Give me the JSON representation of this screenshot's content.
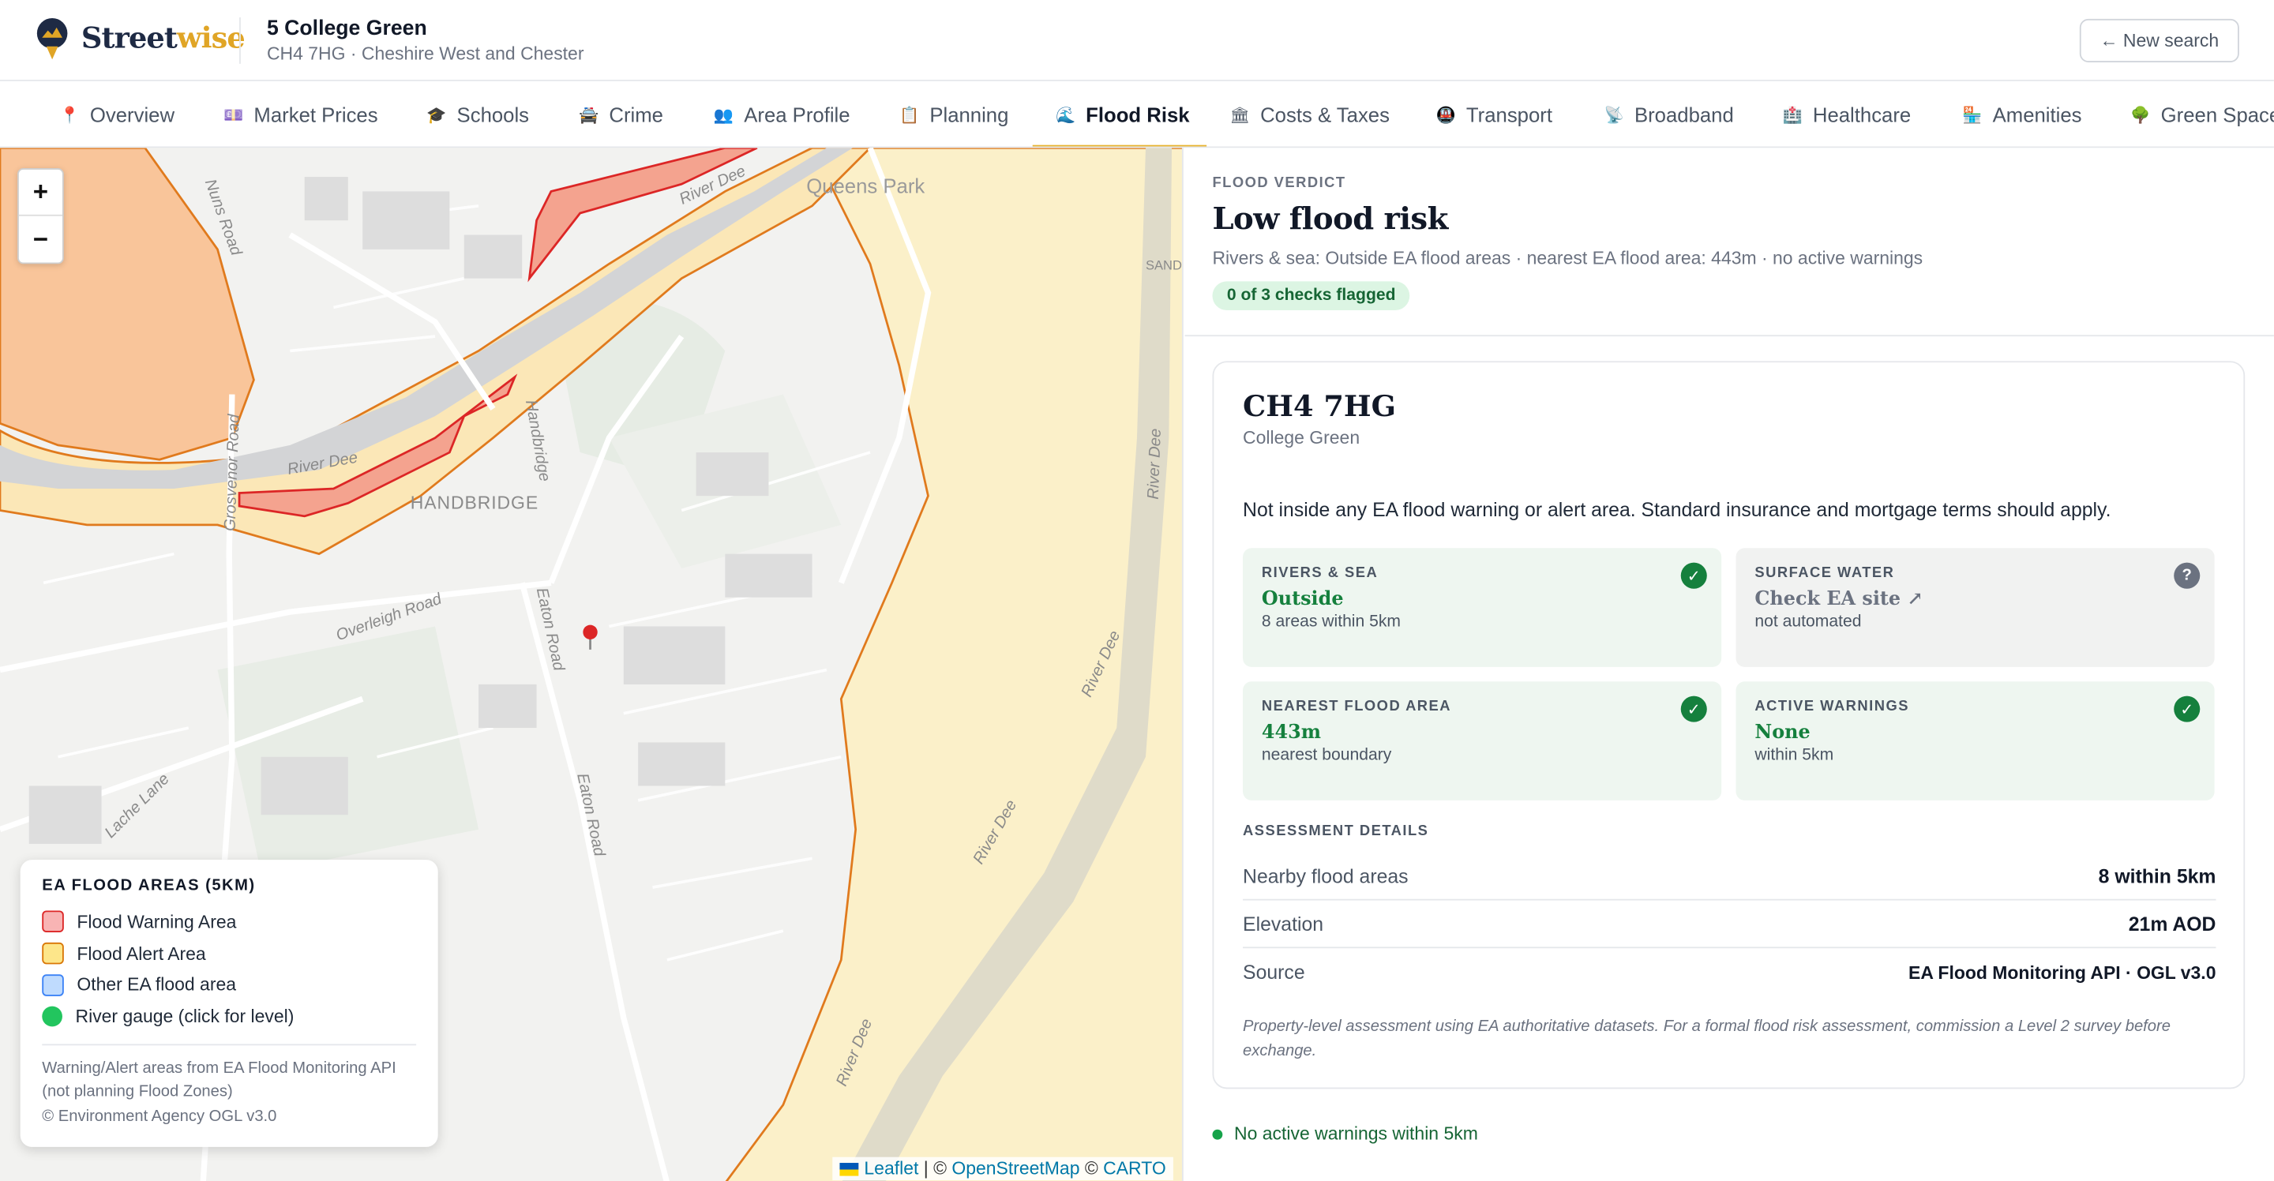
{
  "app": {
    "logo_street": "Street",
    "logo_wise": "wise",
    "new_search_label": "← New search"
  },
  "property": {
    "title": "5 College Green",
    "subtitle": "CH4 7HG · Cheshire West and Chester"
  },
  "tabs": [
    {
      "label": "Overview",
      "icon": "📍"
    },
    {
      "label": "Market Prices",
      "icon": "💷"
    },
    {
      "label": "Schools",
      "icon": "🎓"
    },
    {
      "label": "Crime",
      "icon": "🚔"
    },
    {
      "label": "Area Profile",
      "icon": "👥"
    },
    {
      "label": "Planning",
      "icon": "📋"
    },
    {
      "label": "Flood Risk",
      "icon": "🌊",
      "active": true
    },
    {
      "label": "Costs & Taxes",
      "icon": "🏛"
    },
    {
      "label": "Transport",
      "icon": "🚇"
    },
    {
      "label": "Broadband",
      "icon": "📡"
    },
    {
      "label": "Healthcare",
      "icon": "🏥"
    },
    {
      "label": "Amenities",
      "icon": "🏪"
    },
    {
      "label": "Green Space",
      "icon": "🌳"
    }
  ],
  "map": {
    "zoom_in": "+",
    "zoom_out": "−",
    "labels": {
      "queens_park": "Queens Park",
      "handbridge": "HANDBRIDGE",
      "river_dee": "River Dee",
      "nuns_road": "Nuns Road",
      "grosvenor_road": "Grosvenor Road",
      "handbridge_road": "Handbridge",
      "overleigh_road": "Overleigh Road",
      "eaton_road": "Eaton Road",
      "lache_lane": "Lache Lane",
      "sand": "SAND"
    },
    "legend": {
      "title": "EA FLOOD AREAS (5KM)",
      "items": [
        {
          "label": "Flood Warning Area",
          "color": "#f8b4b4",
          "border": "#dc2626"
        },
        {
          "label": "Flood Alert Area",
          "color": "#fde68a",
          "border": "#d97706"
        },
        {
          "label": "Other EA flood area",
          "color": "#bfdbfe",
          "border": "#3b82f6"
        },
        {
          "label": "River gauge (click for level)",
          "color": "#22c55e"
        }
      ],
      "note_line1": "Warning/Alert areas from EA Flood Monitoring API",
      "note_line2": "(not planning Flood Zones)",
      "note_line3": "© Environment Agency OGL v3.0"
    },
    "attribution": {
      "leaflet": "Leaflet",
      "sep1": " | © ",
      "osm": "OpenStreetMap",
      "sep2": " © ",
      "carto": "CARTO"
    }
  },
  "verdict": {
    "kicker": "FLOOD VERDICT",
    "title": "Low flood risk",
    "summary": "Rivers & sea: Outside EA flood areas · nearest EA flood area: 443m · no active warnings",
    "flag_pill": "0 of 3 checks flagged"
  },
  "card": {
    "postcode": "CH4 7HG",
    "street": "College Green",
    "summary": "Not inside any EA flood warning or alert area. Standard insurance and mortgage terms should apply.",
    "checks": [
      {
        "label": "RIVERS & SEA",
        "value": "Outside",
        "note": "8 areas within 5km",
        "status": "ok"
      },
      {
        "label": "SURFACE WATER",
        "value": "Check EA site ↗",
        "note": "not automated",
        "status": "unknown"
      },
      {
        "label": "NEAREST FLOOD AREA",
        "value": "443m",
        "note": "nearest boundary",
        "status": "ok"
      },
      {
        "label": "ACTIVE WARNINGS",
        "value": "None",
        "note": "within 5km",
        "status": "ok"
      }
    ],
    "details_label": "ASSESSMENT DETAILS",
    "details": [
      {
        "key": "Nearby flood areas",
        "value": "8 within 5km"
      },
      {
        "key": "Elevation",
        "value": "21m AOD"
      },
      {
        "key": "Source",
        "value": "EA Flood Monitoring API · OGL v3.0"
      }
    ],
    "disclaimer": "Property-level assessment using EA authoritative datasets. For a formal flood risk assessment, commission a Level 2 survey before exchange."
  },
  "status": {
    "text": "No active warnings within 5km"
  },
  "colors": {
    "accent": "#e8b431",
    "ok_green": "#15803d",
    "warning_fill": "#f8b4b4",
    "alert_fill": "#fde68a"
  }
}
